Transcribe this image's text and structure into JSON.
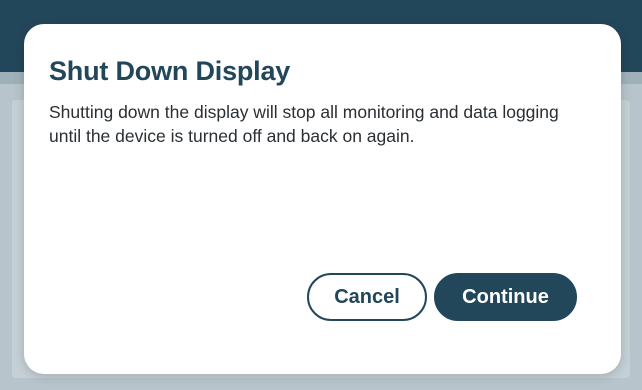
{
  "dialog": {
    "title": "Shut Down Display",
    "message": "Shutting down the display will stop all monitoring and data logging until the device is turned off and back on again.",
    "cancel_label": "Cancel",
    "continue_label": "Continue"
  },
  "colors": {
    "accent": "#23475a",
    "dialog_background": "#ffffff",
    "overlay": "#b7c4cb"
  }
}
